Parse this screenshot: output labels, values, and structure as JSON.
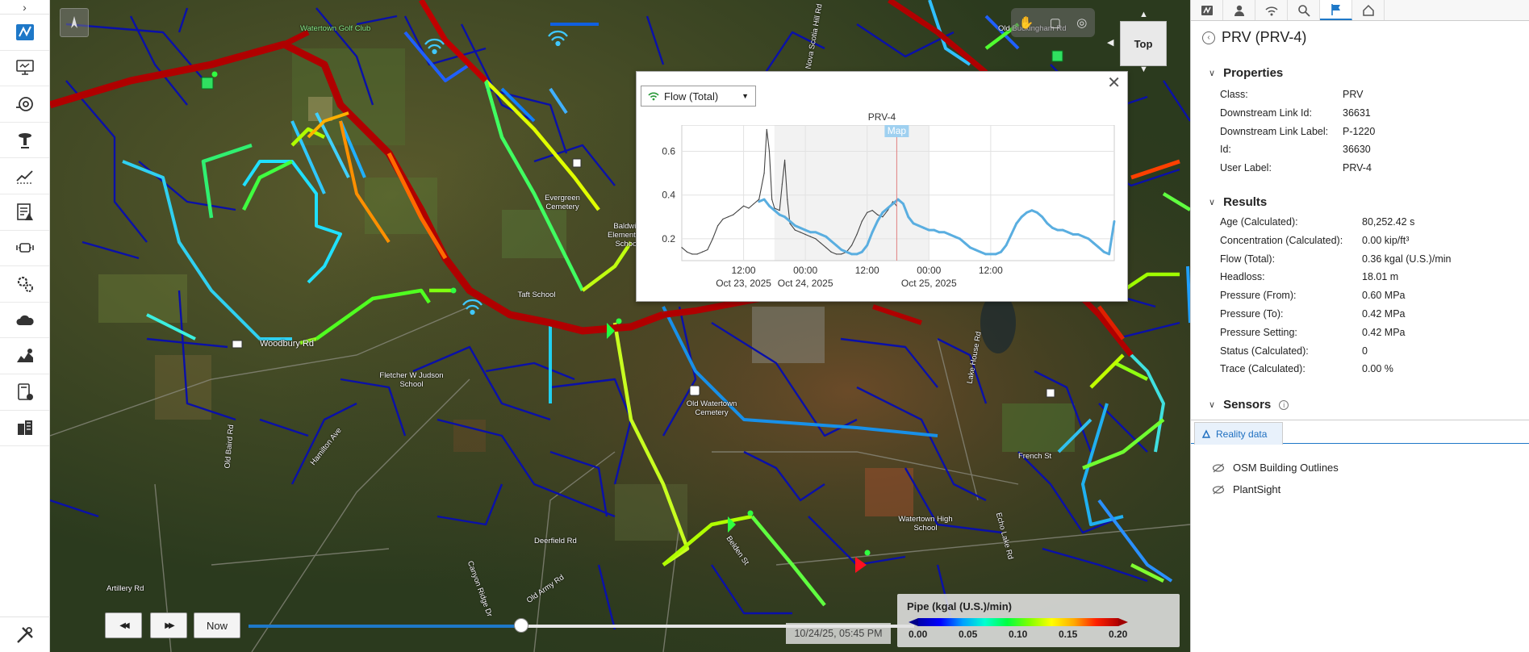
{
  "toolbar": {
    "expand_glyph": "›",
    "tools": [
      {
        "name": "network-map-icon"
      },
      {
        "name": "monitor-icon"
      },
      {
        "name": "pipe-valve-icon"
      },
      {
        "name": "pump-icon"
      },
      {
        "name": "trend-icon"
      },
      {
        "name": "alerts-report-icon"
      },
      {
        "name": "sensor-icon"
      },
      {
        "name": "settings-icon"
      },
      {
        "name": "cloud-icon"
      },
      {
        "name": "analytics-icon"
      },
      {
        "name": "calculator-icon"
      },
      {
        "name": "buildings-icon"
      },
      {
        "name": "tools-icon"
      }
    ]
  },
  "map": {
    "labels": [
      {
        "text": "Watertown Golf Club",
        "cls": "green"
      },
      {
        "text": "Evergreen Cemetery",
        "cls": ""
      },
      {
        "text": "Baldwin Elementary School",
        "cls": ""
      },
      {
        "text": "Taft School",
        "cls": ""
      },
      {
        "text": "Woodbury Rd",
        "cls": ""
      },
      {
        "text": "Fletcher W Judson School",
        "cls": ""
      },
      {
        "text": "Old Watertown Cemetery",
        "cls": ""
      },
      {
        "text": "Watertown High School",
        "cls": ""
      },
      {
        "text": "Hamilton Ave",
        "cls": ""
      },
      {
        "text": "Old Baird Rd",
        "cls": ""
      },
      {
        "text": "Old Army Rd",
        "cls": ""
      },
      {
        "text": "Deerfield Rd",
        "cls": ""
      },
      {
        "text": "Artillery Rd",
        "cls": ""
      },
      {
        "text": "Belden St",
        "cls": ""
      },
      {
        "text": "French St",
        "cls": ""
      },
      {
        "text": "Lake House Rd",
        "cls": ""
      },
      {
        "text": "Canyon Ridge Dr",
        "cls": ""
      },
      {
        "text": "Echo Lake Rd",
        "cls": ""
      },
      {
        "text": "Nova Scotia Hill Rd",
        "cls": ""
      },
      {
        "text": "Old Buckingham Rd",
        "cls": ""
      }
    ],
    "top_view_label": "Top",
    "accent_colors": {
      "pipe_high": "#b00000",
      "pipe_low": "#0000c8",
      "pipe_mid": "#40ff40"
    }
  },
  "chart_popup": {
    "dropdown_label": "Flow (Total)",
    "close_glyph": "✕",
    "map_marker_label": "Map"
  },
  "chart_data": {
    "type": "line",
    "title": "PRV-4",
    "xlabel": "",
    "ylabel": "",
    "ylim": [
      0.1,
      0.72
    ],
    "xlim_hours": [
      0,
      84
    ],
    "yticks": [
      0.2,
      0.4,
      0.6
    ],
    "xticks": [
      {
        "hour": 12,
        "line1": "12:00",
        "line2": "Oct 23, 2025"
      },
      {
        "hour": 24,
        "line1": "00:00",
        "line2": "Oct 24, 2025"
      },
      {
        "hour": 36,
        "line1": "12:00",
        "line2": ""
      },
      {
        "hour": 48,
        "line1": "00:00",
        "line2": "Oct 25, 2025"
      },
      {
        "hour": 60,
        "line1": "12:00",
        "line2": ""
      }
    ],
    "current_time_hour": 41.75,
    "shaded_range_hours": [
      18,
      48
    ],
    "series": [
      {
        "name": "",
        "color": "#444444",
        "x": [
          0,
          1,
          2,
          3,
          4,
          5,
          6,
          7,
          8,
          9,
          10,
          11,
          12,
          13,
          14,
          15,
          16,
          16.5,
          17,
          17.5,
          18,
          19,
          19.5,
          20,
          20.5,
          21,
          22,
          23,
          24,
          25,
          26,
          27,
          28,
          29,
          30,
          31,
          32,
          33,
          34,
          35,
          36,
          37,
          38,
          39,
          40,
          41,
          41.75
        ],
        "y": [
          0.16,
          0.14,
          0.13,
          0.13,
          0.14,
          0.15,
          0.2,
          0.26,
          0.29,
          0.3,
          0.31,
          0.33,
          0.35,
          0.34,
          0.36,
          0.38,
          0.5,
          0.7,
          0.6,
          0.38,
          0.34,
          0.33,
          0.45,
          0.56,
          0.38,
          0.27,
          0.24,
          0.23,
          0.22,
          0.21,
          0.2,
          0.18,
          0.16,
          0.14,
          0.13,
          0.13,
          0.14,
          0.17,
          0.22,
          0.28,
          0.32,
          0.33,
          0.31,
          0.3,
          0.33,
          0.37,
          0.35
        ]
      },
      {
        "name": "",
        "color": "#5aaee0",
        "x": [
          15,
          16,
          17,
          18,
          19,
          20,
          21,
          22,
          23,
          24,
          25,
          26,
          27,
          28,
          29,
          30,
          31,
          32,
          33,
          34,
          35,
          36,
          37,
          38,
          39,
          40,
          41,
          42,
          43,
          44,
          45,
          46,
          47,
          48,
          49,
          50,
          51,
          52,
          53,
          54,
          55,
          56,
          57,
          58,
          59,
          60,
          61,
          62,
          63,
          64,
          65,
          66,
          67,
          68,
          69,
          70,
          71,
          72,
          73,
          74,
          75,
          76,
          77,
          78,
          79,
          80,
          81,
          82,
          83,
          84
        ],
        "y": [
          0.37,
          0.38,
          0.35,
          0.33,
          0.31,
          0.3,
          0.28,
          0.26,
          0.25,
          0.24,
          0.23,
          0.23,
          0.22,
          0.21,
          0.19,
          0.17,
          0.15,
          0.14,
          0.13,
          0.13,
          0.14,
          0.17,
          0.23,
          0.28,
          0.32,
          0.34,
          0.36,
          0.38,
          0.36,
          0.3,
          0.27,
          0.26,
          0.25,
          0.24,
          0.24,
          0.23,
          0.23,
          0.22,
          0.21,
          0.2,
          0.18,
          0.16,
          0.15,
          0.14,
          0.13,
          0.13,
          0.13,
          0.14,
          0.17,
          0.22,
          0.27,
          0.3,
          0.32,
          0.33,
          0.32,
          0.3,
          0.27,
          0.25,
          0.24,
          0.24,
          0.23,
          0.22,
          0.22,
          0.21,
          0.2,
          0.18,
          0.16,
          0.14,
          0.13,
          0.28
        ]
      }
    ]
  },
  "timebar": {
    "rewind_glyph": "◀◀",
    "forward_glyph": "▶▶",
    "now_label": "Now",
    "timestamp": "10/24/25, 05:45 PM",
    "progress": 0.41
  },
  "legend": {
    "title": "Pipe (kgal (U.S.)/min)",
    "ticks": [
      "0.00",
      "0.05",
      "0.10",
      "0.15",
      "0.20"
    ]
  },
  "panel": {
    "tabs": [
      "network-view-icon",
      "user-icon",
      "signal-icon",
      "search-icon",
      "flag-icon",
      "home-icon"
    ],
    "title": "PRV (PRV-4)",
    "properties_heading": "Properties",
    "properties": [
      {
        "key": "Class:",
        "value": "PRV"
      },
      {
        "key": "Downstream Link Id:",
        "value": "36631"
      },
      {
        "key": "Downstream Link Label:",
        "value": "P-1220"
      },
      {
        "key": "Id:",
        "value": "36630"
      },
      {
        "key": "User Label:",
        "value": "PRV-4"
      }
    ],
    "results_heading": "Results",
    "results": [
      {
        "key": "Age (Calculated):",
        "value": "80,252.42 s"
      },
      {
        "key": "Concentration (Calculated):",
        "value": "0.00 kip/ft³"
      },
      {
        "key": "Flow (Total):",
        "value": "0.36 kgal (U.S.)/min"
      },
      {
        "key": "Headloss:",
        "value": "18.01 m"
      },
      {
        "key": "Pressure (From):",
        "value": "0.60 MPa"
      },
      {
        "key": "Pressure (To):",
        "value": "0.42 MPa"
      },
      {
        "key": "Pressure Setting:",
        "value": "0.42 MPa"
      },
      {
        "key": "Status (Calculated):",
        "value": "0"
      },
      {
        "key": "Trace (Calculated):",
        "value": "0.00 %"
      }
    ],
    "sensors_heading": "Sensors",
    "reality_tab_label": "Reality data",
    "layers": [
      "OSM Building Outlines",
      "PlantSight"
    ]
  }
}
